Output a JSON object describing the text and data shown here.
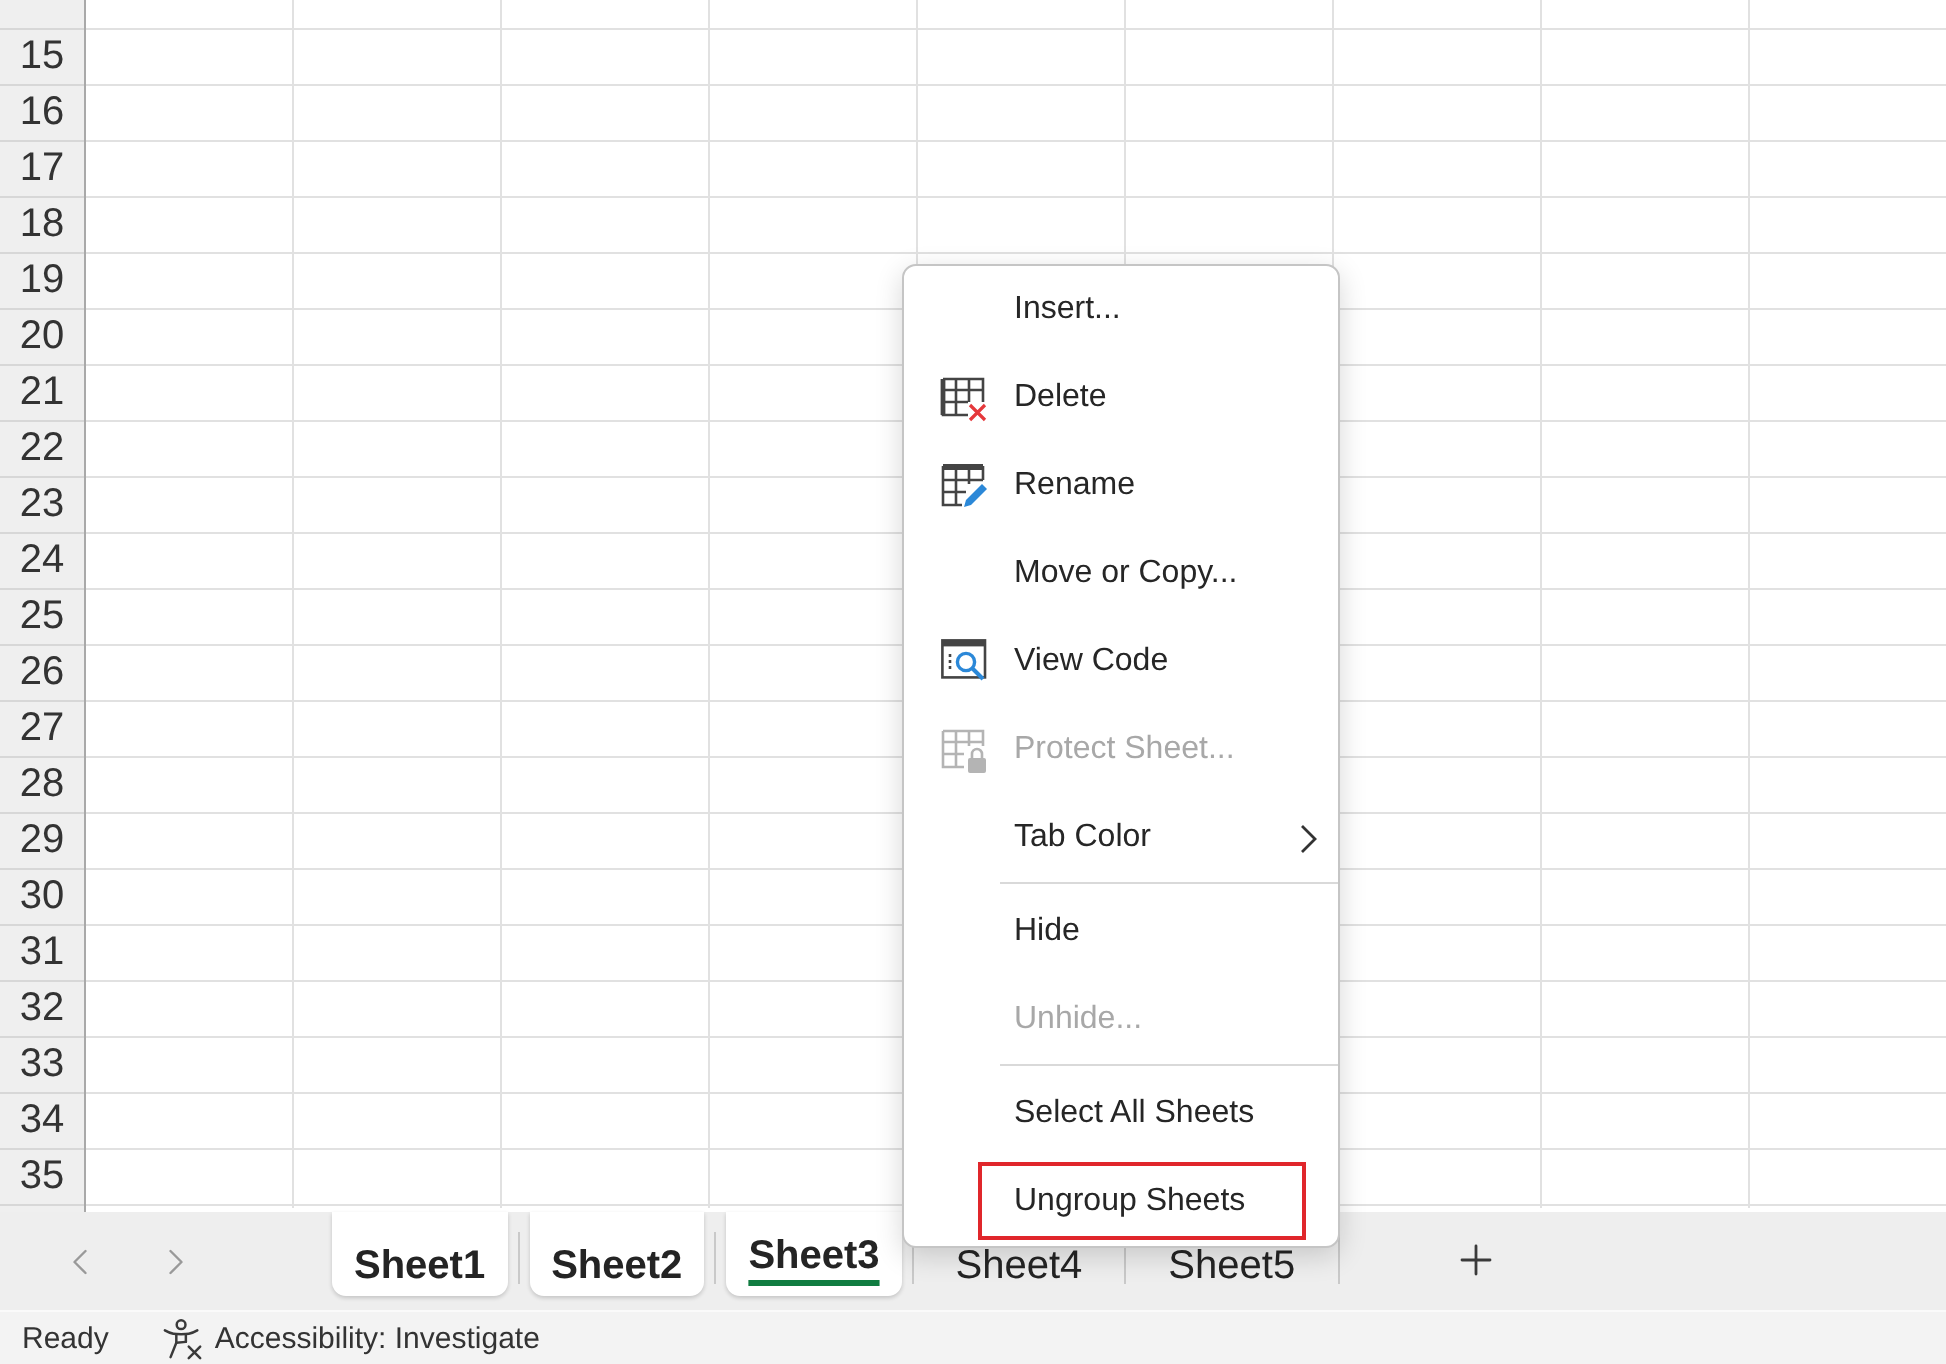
{
  "sheet": {
    "row_headers": [
      "15",
      "16",
      "17",
      "18",
      "19",
      "20",
      "21",
      "22",
      "23",
      "24",
      "25",
      "26",
      "27",
      "28",
      "29",
      "30",
      "31",
      "32",
      "33",
      "34",
      "35"
    ]
  },
  "context_menu": {
    "groups": [
      {
        "items": [
          {
            "kind": "plain",
            "label": "Insert...",
            "disabled": false,
            "has_submenu": false,
            "outlined": false
          },
          {
            "kind": "delete",
            "label": "Delete",
            "disabled": false,
            "has_submenu": false,
            "outlined": false
          },
          {
            "kind": "rename",
            "label": "Rename",
            "disabled": false,
            "has_submenu": false,
            "outlined": false
          },
          {
            "kind": "plain",
            "label": "Move or Copy...",
            "disabled": false,
            "has_submenu": false,
            "outlined": false
          },
          {
            "kind": "code",
            "label": "View Code",
            "disabled": false,
            "has_submenu": false,
            "outlined": false
          },
          {
            "kind": "protect",
            "label": "Protect Sheet...",
            "disabled": true,
            "has_submenu": false,
            "outlined": false
          },
          {
            "kind": "plain",
            "label": "Tab Color",
            "disabled": false,
            "has_submenu": true,
            "outlined": false
          }
        ]
      },
      {
        "items": [
          {
            "kind": "plain",
            "label": "Hide",
            "disabled": false,
            "has_submenu": false,
            "outlined": false
          },
          {
            "kind": "plain",
            "label": "Unhide...",
            "disabled": true,
            "has_submenu": false,
            "outlined": false
          }
        ]
      },
      {
        "items": [
          {
            "kind": "plain",
            "label": "Select All Sheets",
            "disabled": false,
            "has_submenu": false,
            "outlined": false
          },
          {
            "kind": "plain",
            "label": "Ungroup Sheets",
            "disabled": false,
            "has_submenu": false,
            "outlined": true
          }
        ]
      }
    ]
  },
  "tab_bar": {
    "tabs": [
      {
        "label": "Sheet1",
        "selected": true,
        "active": false
      },
      {
        "label": "Sheet2",
        "selected": true,
        "active": false
      },
      {
        "label": "Sheet3",
        "selected": true,
        "active": true
      },
      {
        "label": "Sheet4",
        "selected": false,
        "active": false
      },
      {
        "label": "Sheet5",
        "selected": false,
        "active": false
      }
    ]
  },
  "status_bar": {
    "status": "Ready",
    "accessibility": "Accessibility: Investigate"
  }
}
